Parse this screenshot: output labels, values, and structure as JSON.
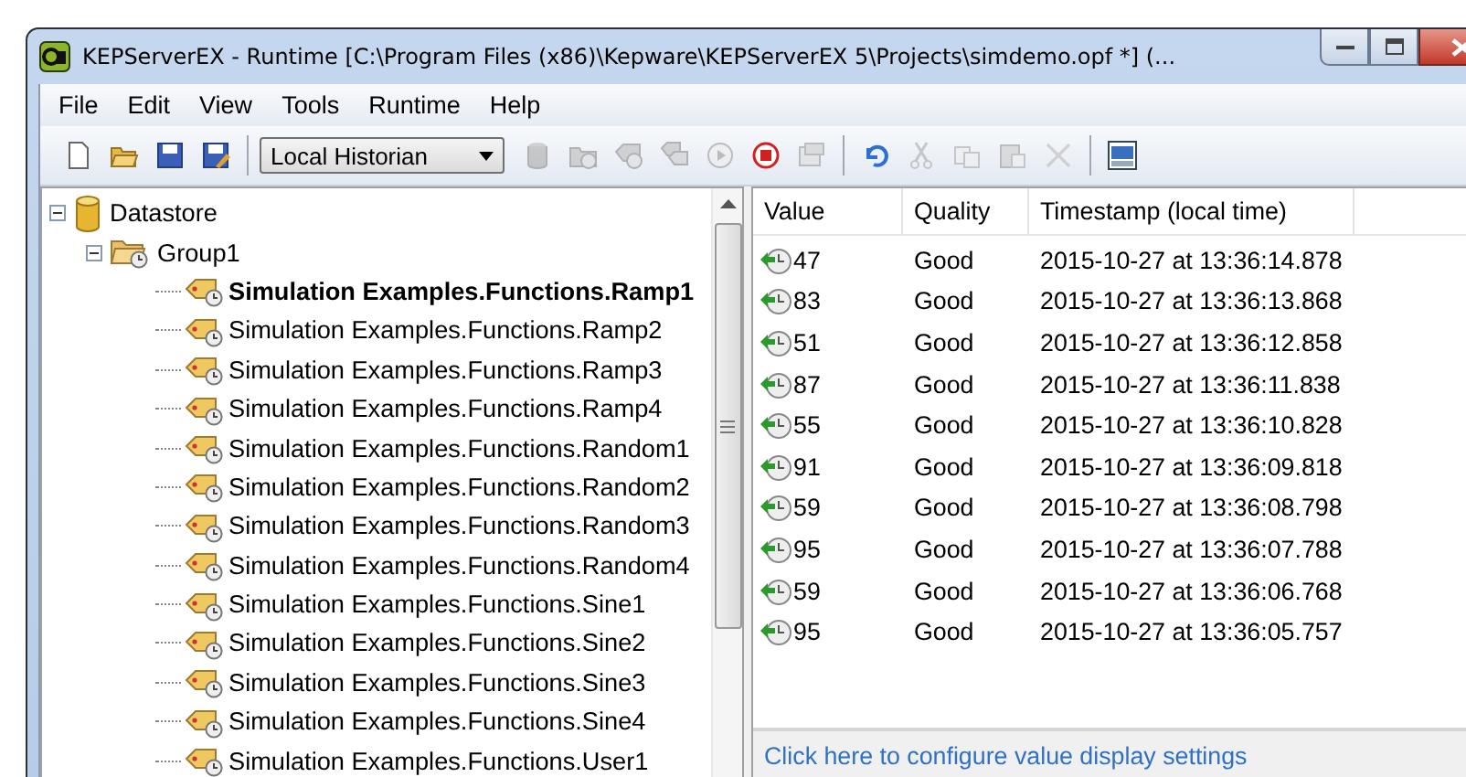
{
  "window": {
    "title": "KEPServerEX - Runtime [C:\\Program Files (x86)\\Kepware\\KEPServerEX 5\\Projects\\simdemo.opf *] (..."
  },
  "menu": [
    "File",
    "Edit",
    "View",
    "Tools",
    "Runtime",
    "Help"
  ],
  "toolbar": {
    "left": [
      {
        "kind": "new",
        "disabled": false
      },
      {
        "kind": "open",
        "disabled": false
      },
      {
        "kind": "save",
        "disabled": false
      },
      {
        "kind": "save-as",
        "disabled": false
      }
    ],
    "dropdown": {
      "value": "Local Historian"
    },
    "right": [
      {
        "kind": "database",
        "disabled": true
      },
      {
        "kind": "group",
        "disabled": true
      },
      {
        "kind": "tag",
        "disabled": true
      },
      {
        "kind": "tags",
        "disabled": true
      },
      {
        "kind": "play",
        "disabled": true
      },
      {
        "kind": "stop",
        "disabled": false
      },
      {
        "kind": "properties",
        "disabled": true
      },
      {
        "kind": "sep"
      },
      {
        "kind": "undo",
        "disabled": false
      },
      {
        "kind": "cut",
        "disabled": true
      },
      {
        "kind": "copy",
        "disabled": true
      },
      {
        "kind": "paste",
        "disabled": true
      },
      {
        "kind": "delete",
        "disabled": true
      },
      {
        "kind": "sep"
      },
      {
        "kind": "qc",
        "disabled": false
      }
    ]
  },
  "tree": [
    {
      "label": "Datastore",
      "expanded": true,
      "selected": false,
      "children": [
        {
          "label": "Group1",
          "expanded": true,
          "selected": false,
          "children": [
            {
              "label": "Simulation Examples.Functions.Ramp1",
              "selected": true
            },
            {
              "label": "Simulation Examples.Functions.Ramp2",
              "selected": false
            },
            {
              "label": "Simulation Examples.Functions.Ramp3",
              "selected": false
            },
            {
              "label": "Simulation Examples.Functions.Ramp4",
              "selected": false
            },
            {
              "label": "Simulation Examples.Functions.Random1",
              "selected": false
            },
            {
              "label": "Simulation Examples.Functions.Random2",
              "selected": false
            },
            {
              "label": "Simulation Examples.Functions.Random3",
              "selected": false
            },
            {
              "label": "Simulation Examples.Functions.Random4",
              "selected": false
            },
            {
              "label": "Simulation Examples.Functions.Sine1",
              "selected": false
            },
            {
              "label": "Simulation Examples.Functions.Sine2",
              "selected": false
            },
            {
              "label": "Simulation Examples.Functions.Sine3",
              "selected": false
            },
            {
              "label": "Simulation Examples.Functions.Sine4",
              "selected": false
            },
            {
              "label": "Simulation Examples.Functions.User1",
              "selected": false
            }
          ]
        }
      ]
    }
  ],
  "table": {
    "columns": [
      "Value",
      "Quality",
      "Timestamp (local time)"
    ],
    "rows": [
      {
        "value": "47",
        "quality": "Good",
        "timestamp": "2015-10-27 at 13:36:14.878"
      },
      {
        "value": "83",
        "quality": "Good",
        "timestamp": "2015-10-27 at 13:36:13.868"
      },
      {
        "value": "51",
        "quality": "Good",
        "timestamp": "2015-10-27 at 13:36:12.858"
      },
      {
        "value": "87",
        "quality": "Good",
        "timestamp": "2015-10-27 at 13:36:11.838"
      },
      {
        "value": "55",
        "quality": "Good",
        "timestamp": "2015-10-27 at 13:36:10.828"
      },
      {
        "value": "91",
        "quality": "Good",
        "timestamp": "2015-10-27 at 13:36:09.818"
      },
      {
        "value": "59",
        "quality": "Good",
        "timestamp": "2015-10-27 at 13:36:08.798"
      },
      {
        "value": "95",
        "quality": "Good",
        "timestamp": "2015-10-27 at 13:36:07.788"
      },
      {
        "value": "59",
        "quality": "Good",
        "timestamp": "2015-10-27 at 13:36:06.768"
      },
      {
        "value": "95",
        "quality": "Good",
        "timestamp": "2015-10-27 at 13:36:05.757"
      }
    ]
  },
  "settings_link": "Click here to configure value display settings"
}
